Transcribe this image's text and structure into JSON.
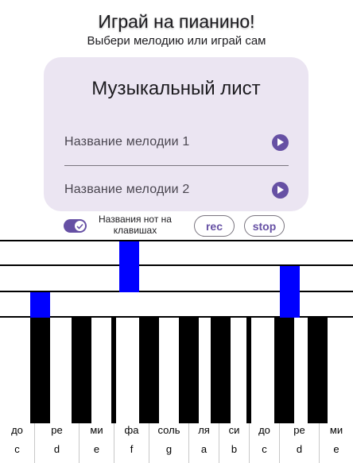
{
  "header": {
    "title": "Играй на пианино!",
    "subtitle": "Выбери мелодию или играй сам"
  },
  "songs_card": {
    "title": "Музыкальный лист",
    "songs": [
      {
        "title": "Название мелодии 1",
        "icon": "play-icon"
      },
      {
        "title": "Название мелодии 2",
        "icon": "play-icon"
      }
    ]
  },
  "controls": {
    "note_names_toggle": {
      "label": "Названия нот на клавишах",
      "on": true,
      "icon": "check-icon"
    },
    "rec_label": "rec",
    "stop_label": "stop"
  },
  "piano": {
    "white_keys": [
      {
        "ru": "до",
        "en": "c"
      },
      {
        "ru": "ре",
        "en": "d"
      },
      {
        "ru": "ми",
        "en": "e"
      },
      {
        "ru": "фа",
        "en": "f"
      },
      {
        "ru": "соль",
        "en": "g"
      },
      {
        "ru": "ля",
        "en": "a"
      },
      {
        "ru": "си",
        "en": "b"
      },
      {
        "ru": "до",
        "en": "c"
      },
      {
        "ru": "ре",
        "en": "d"
      },
      {
        "ru": "ми",
        "en": "e"
      }
    ],
    "black_keys_count": 9
  },
  "colors": {
    "accent": "#6650a4",
    "card_bg": "#ebe5f2",
    "note_fill": "#0000ff",
    "key_black": "#000000"
  }
}
